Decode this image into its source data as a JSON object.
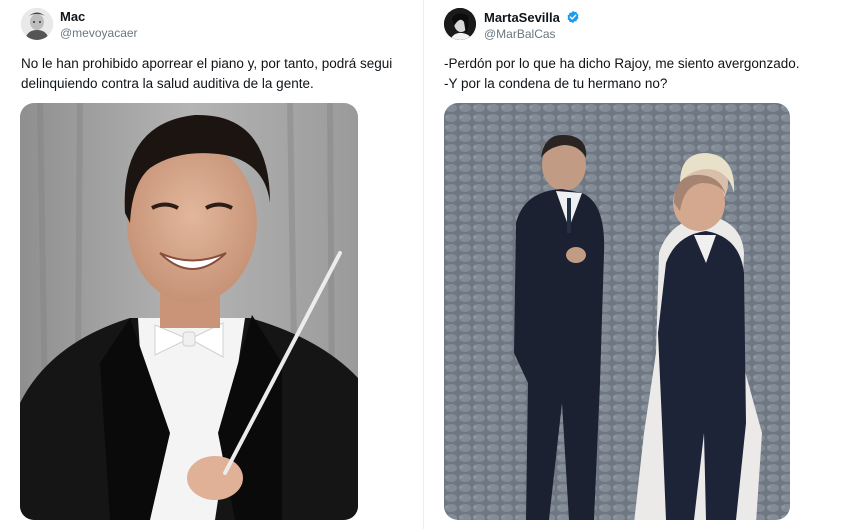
{
  "tweets": [
    {
      "author_name": "Mac",
      "handle": "@mevoyacaer",
      "text_line1": "No le han prohibido aporrear el piano y, por tanto, podrá segui",
      "text_line2": "delinquiendo contra la salud auditiva de la gente.",
      "verified": false,
      "media_icon": "conductor-photo"
    },
    {
      "author_name": "MartaSevilla",
      "handle": "@MarBalCas",
      "text_line1": "-Perdón por lo que ha dicho Rajoy, me siento avergonzado.",
      "text_line2": "-Y por la condena de tu hermano no?",
      "verified": true,
      "media_icon": "politicians-photo"
    }
  ],
  "colors": {
    "verified_badge": "#1d9bf0",
    "handle_text": "#6b7780"
  }
}
